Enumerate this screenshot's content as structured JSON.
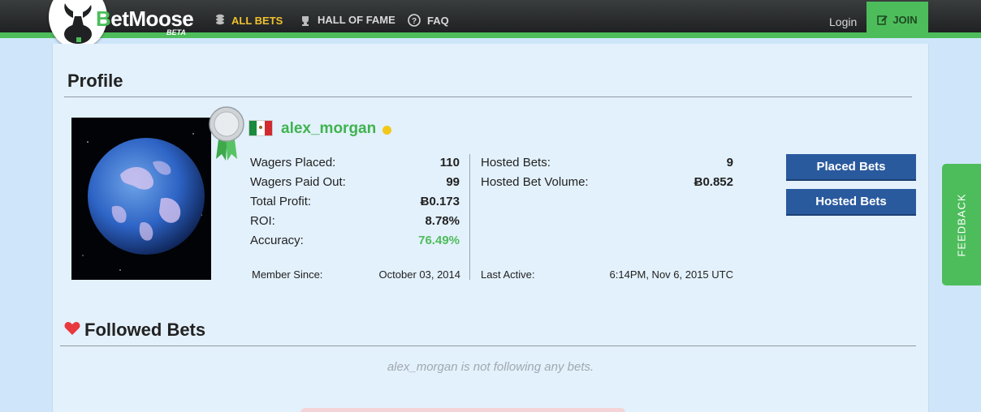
{
  "nav": {
    "logo_prefix": "B",
    "logo_rest": "etMoose",
    "logo_badge": "BETA",
    "all_bets": "ALL BETS",
    "hall_of_fame": "HALL OF FAME",
    "faq": "FAQ",
    "login": "Login",
    "join": "JOIN"
  },
  "profile": {
    "title": "Profile",
    "username": "alex_morgan",
    "country_flag": "mexico-flag",
    "online_status": "online",
    "left_stats": [
      {
        "label": "Wagers Placed:",
        "value": "110"
      },
      {
        "label": "Wagers Paid Out:",
        "value": "99"
      },
      {
        "label": "Total Profit:",
        "value": "Ƀ0.173"
      },
      {
        "label": "ROI:",
        "value": "8.78%"
      },
      {
        "label": "Accuracy:",
        "value": "76.49%"
      }
    ],
    "right_stats": [
      {
        "label": "Hosted Bets:",
        "value": "9"
      },
      {
        "label": "Hosted Bet Volume:",
        "value": "Ƀ0.852"
      }
    ],
    "member_since_label": "Member Since:",
    "member_since_value": "October 03, 2014",
    "last_active_label": "Last Active:",
    "last_active_value": "6:14PM, Nov 6, 2015 UTC",
    "placed_bets_button": "Placed Bets",
    "hosted_bets_button": "Hosted Bets"
  },
  "followed": {
    "title": "Followed Bets",
    "empty_message": "alex_morgan is not following any bets."
  },
  "feedback_tab": "FEEDBACK",
  "colors": {
    "accent_green": "#4dbd5b",
    "nav_active": "#f2c12e",
    "button_blue": "#2a5a9e",
    "background": "#cfe6fa"
  }
}
